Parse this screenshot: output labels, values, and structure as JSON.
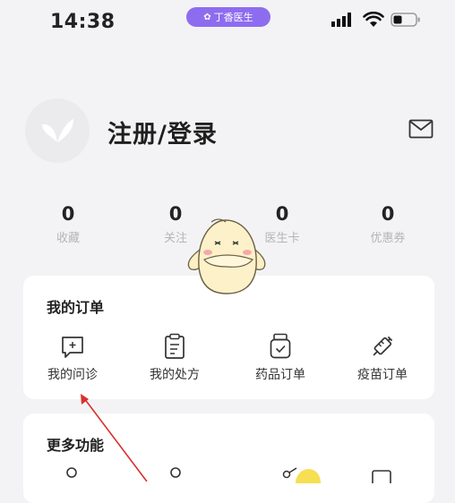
{
  "status_bar": {
    "time": "14:38",
    "app_pill_label": "丁香医生"
  },
  "profile": {
    "login_label": "注册/登录"
  },
  "stats": [
    {
      "value": "0",
      "label": "收藏"
    },
    {
      "value": "0",
      "label": "关注"
    },
    {
      "value": "0",
      "label": "医生卡"
    },
    {
      "value": "0",
      "label": "优惠券"
    }
  ],
  "orders": {
    "title": "我的订单",
    "items": [
      {
        "label": "我的问诊",
        "icon": "consultation-icon"
      },
      {
        "label": "我的处方",
        "icon": "prescription-icon"
      },
      {
        "label": "药品订单",
        "icon": "medicine-order-icon"
      },
      {
        "label": "疫苗订单",
        "icon": "vaccine-order-icon"
      }
    ]
  },
  "more": {
    "title": "更多功能"
  },
  "colors": {
    "accent": "#8e6cf0",
    "annotation_arrow": "#d9302c",
    "background": "#f3f3f5"
  }
}
